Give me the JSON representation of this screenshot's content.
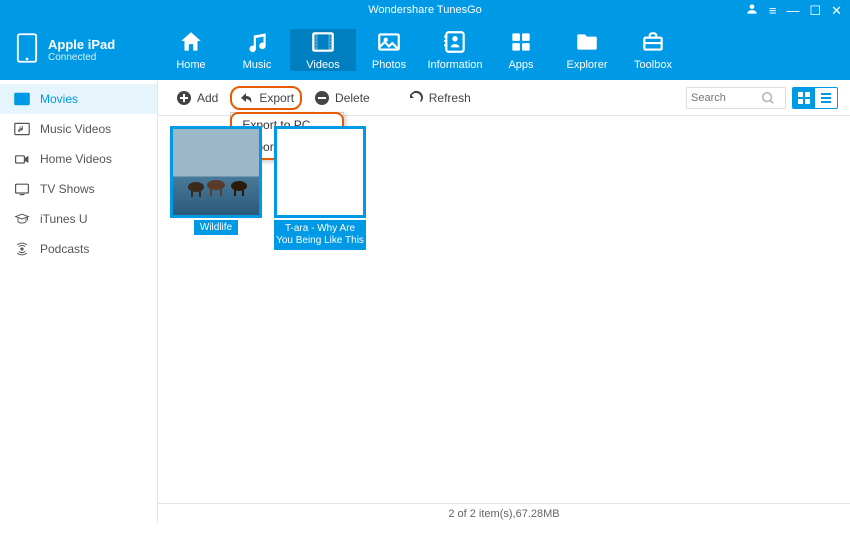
{
  "app": {
    "title": "Wondershare TunesGo"
  },
  "device": {
    "name": "Apple iPad",
    "status": "Connected"
  },
  "nav": {
    "home": "Home",
    "music": "Music",
    "videos": "Videos",
    "photos": "Photos",
    "information": "Information",
    "apps": "Apps",
    "explorer": "Explorer",
    "toolbox": "Toolbox"
  },
  "sidebar": {
    "movies": "Movies",
    "music_videos": "Music Videos",
    "home_videos": "Home Videos",
    "tv_shows": "TV Shows",
    "itunes_u": "iTunes U",
    "podcasts": "Podcasts"
  },
  "toolbar": {
    "add": "Add",
    "export": "Export",
    "delete": "Delete",
    "refresh": "Refresh",
    "search_placeholder": "Search"
  },
  "export_menu": {
    "to_pc": "Export to PC",
    "to_itunes": "Export to iTunes"
  },
  "items": [
    {
      "title": "Wildlife"
    },
    {
      "title": "T-ara - Why Are You Being Like This"
    }
  ],
  "status": "2 of 2 item(s),67.28MB"
}
